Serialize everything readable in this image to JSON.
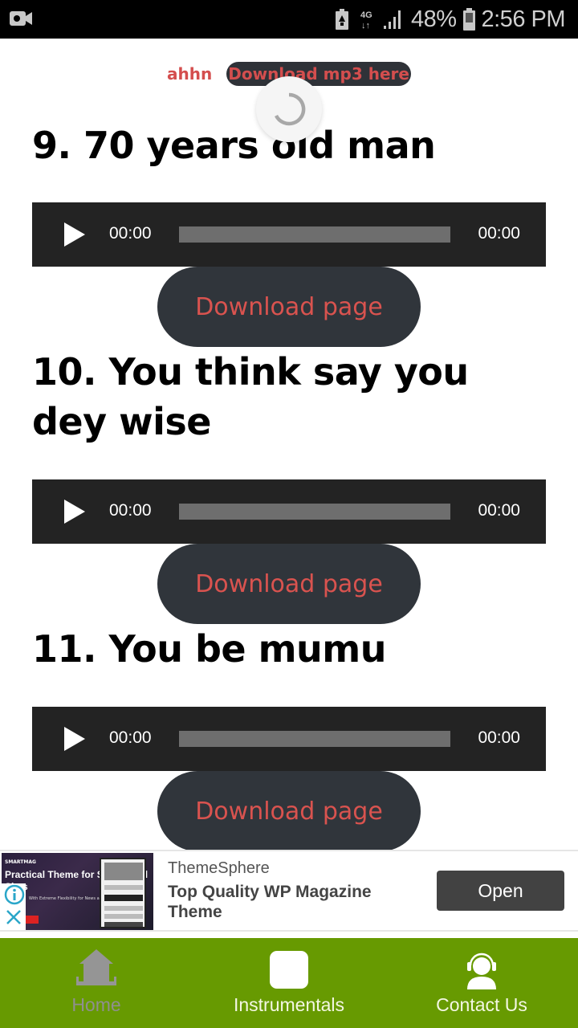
{
  "status_bar": {
    "left_icon": "video-camera-icon",
    "icons": [
      "battery-saver-icon",
      "network-4g-icon",
      "signal-strength-icon"
    ],
    "battery_percent": "48%",
    "battery_icon": "battery-icon",
    "time": "2:56 PM"
  },
  "top_links": {
    "ahhn": "ahhn",
    "download_mp3": "Download mp3 here"
  },
  "loading": {
    "icon": "loading-spinner-icon"
  },
  "songs": [
    {
      "title": "9. 70 years old man",
      "player": {
        "current_time": "00:00",
        "duration": "00:00",
        "progress": 0
      },
      "download_label": "Download page"
    },
    {
      "title": "10. You think say you dey wise",
      "player": {
        "current_time": "00:00",
        "duration": "00:00",
        "progress": 0
      },
      "download_label": "Download page"
    },
    {
      "title": "11. You be mumu",
      "player": {
        "current_time": "00:00",
        "duration": "00:00",
        "progress": 0
      },
      "download_label": "Download page"
    }
  ],
  "ad": {
    "image_brand": "SMARTMAG",
    "image_headline": "Practical Theme for Successful Sites",
    "image_sub": "With Extreme Flexibility for News and Blogs",
    "advertiser": "ThemeSphere",
    "headline": "Top Quality WP Magazine Theme",
    "cta": "Open",
    "info_icon": "info-icon",
    "close_icon": "close-icon"
  },
  "bottom_nav": {
    "items": [
      {
        "label": "Home",
        "icon": "home-icon",
        "active": false
      },
      {
        "label": "Instrumentals",
        "icon": "square-icon",
        "active": true
      },
      {
        "label": "Contact Us",
        "icon": "support-headset-icon",
        "active": true
      }
    ]
  },
  "colors": {
    "accent_red": "#d9534f",
    "button_dark": "#30353b",
    "player_bg": "#232323",
    "nav_green": "#679a01"
  }
}
